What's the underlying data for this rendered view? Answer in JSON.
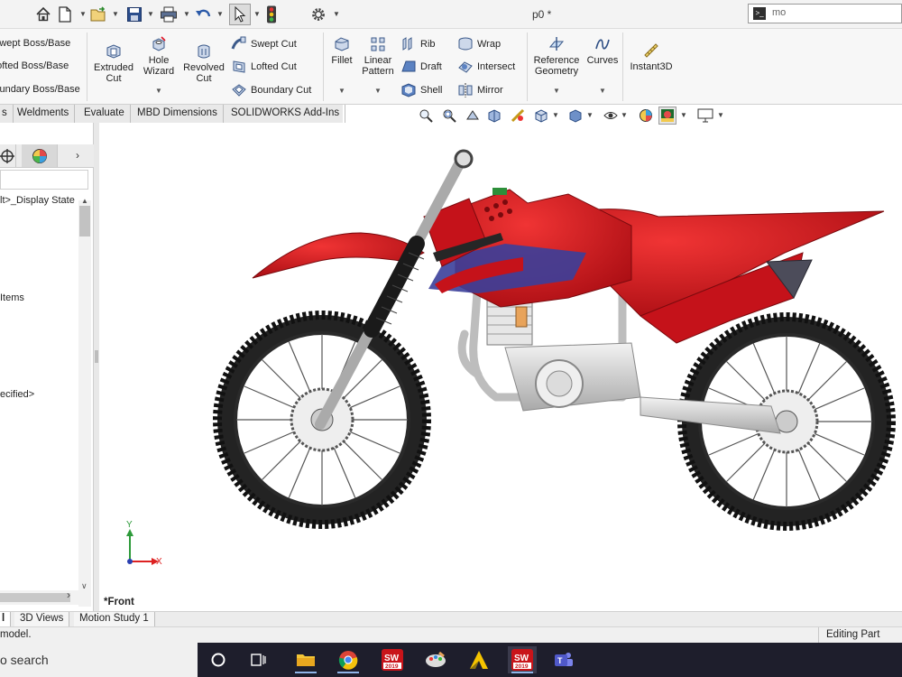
{
  "window": {
    "document_title": "p0 *",
    "search_text": "mo"
  },
  "quick_access": {
    "icons": [
      "home-icon",
      "new-file-icon",
      "open-file-icon",
      "save-icon",
      "print-icon",
      "undo-icon",
      "select-arrow-icon",
      "rebuild-traffic-light-icon",
      "options-gear-icon"
    ]
  },
  "ribbon": {
    "boss_base": [
      "Swept Boss/Base",
      "Lofted Boss/Base",
      "Boundary Boss/Base"
    ],
    "extruded_cut": "Extruded Cut",
    "hole_wizard": "Hole Wizard",
    "revolved_cut": "Revolved Cut",
    "cut_small": [
      "Swept Cut",
      "Lofted Cut",
      "Boundary Cut"
    ],
    "fillet": "Fillet",
    "linear_pattern": "Linear Pattern",
    "features_small": [
      "Rib",
      "Draft",
      "Shell"
    ],
    "features_small2": [
      "Wrap",
      "Intersect",
      "Mirror"
    ],
    "reference_geometry": "Reference Geometry",
    "curves": "Curves",
    "instant3d": "Instant3D"
  },
  "tabs": [
    "s",
    "Weldments",
    "Evaluate",
    "MBD Dimensions",
    "SOLIDWORKS Add-Ins"
  ],
  "feature_tree": {
    "lines": [
      "lt>_Display State",
      "Items",
      "ecified>"
    ]
  },
  "graphics": {
    "view_label": "*Front",
    "triad_x": "X",
    "triad_y": "Y",
    "colors": {
      "body_red": "#d4141a",
      "tire": "#1c1c1c",
      "frame": "#c8c8c8"
    }
  },
  "bottom_tabs": [
    "l",
    "3D Views",
    "Motion Study 1"
  ],
  "status": {
    "message": "model.",
    "editing": "Editing Part"
  },
  "taskbar": {
    "search_text": "o search",
    "apps": [
      "cortana-circle-icon",
      "task-view-icon",
      "file-explorer-icon",
      "chrome-icon",
      "solidworks-2019-icon",
      "paint-palette-icon",
      "autocad-icon",
      "solidworks-2019-active-icon",
      "teams-icon"
    ],
    "sw_year": "2019"
  }
}
